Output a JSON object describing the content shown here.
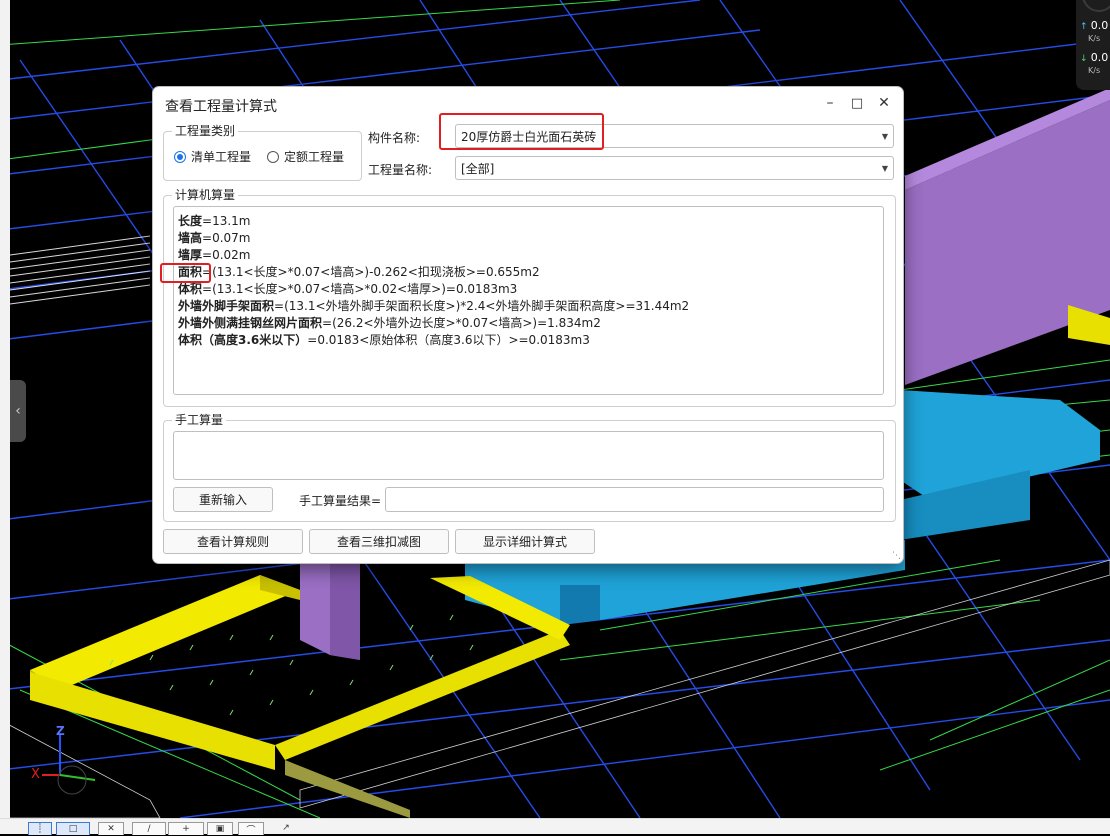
{
  "dialog": {
    "title": "查看工程量计算式",
    "qty_type": {
      "legend": "工程量类别",
      "options": [
        "清单工程量",
        "定额工程量"
      ],
      "selected": "清单工程量"
    },
    "component_name": {
      "label": "构件名称:",
      "value": "20厚仿爵士白光面石英砖"
    },
    "quantity_name": {
      "label": "工程量名称:",
      "value": "[全部]"
    },
    "computer_calc": {
      "legend": "计算机算量",
      "lines": [
        {
          "name": "长度",
          "expr": "=13.1m"
        },
        {
          "name": "墙高",
          "expr": "=0.07m"
        },
        {
          "name": "墙厚",
          "expr": "=0.02m"
        },
        {
          "name": "面积",
          "expr": "=(13.1<长度>*0.07<墙高>)-0.262<扣现浇板>=0.655m2"
        },
        {
          "name": "体积",
          "expr": "=(13.1<长度>*0.07<墙高>*0.02<墙厚>)=0.0183m3"
        },
        {
          "name": "外墙外脚手架面积",
          "expr": "=(13.1<外墙外脚手架面积长度>)*2.4<外墙外脚手架面积高度>=31.44m2"
        },
        {
          "name": "外墙外侧满挂钢丝网片面积",
          "expr": "=(26.2<外墙外边长度>*0.07<墙高>)=1.834m2"
        },
        {
          "name": "体积（高度3.6米以下）",
          "expr": "=0.0183<原始体积（高度3.6以下）>=0.0183m3"
        }
      ]
    },
    "manual_calc": {
      "legend": "手工算量",
      "reenter_button": "重新输入",
      "result_label": "手工算量结果=",
      "result_value": ""
    },
    "buttons": {
      "view_rules": "查看计算规则",
      "view_3d": "查看三维扣减图",
      "show_detail": "显示详细计算式"
    }
  },
  "net_widget": {
    "up": {
      "value": "0.0",
      "unit": "K/s"
    },
    "down": {
      "value": "0.0",
      "unit": "K/s"
    }
  },
  "axis_labels": {
    "x": "X",
    "z": "Z"
  },
  "colors": {
    "accent": "#1a73e8",
    "highlight": "#e02020",
    "wall_yellow": "#e8e000",
    "wall_purple": "#9a6fc4",
    "wall_blue": "#1fa3d8",
    "cad_line": "#2a55ff",
    "cad_green": "#36d94a"
  }
}
